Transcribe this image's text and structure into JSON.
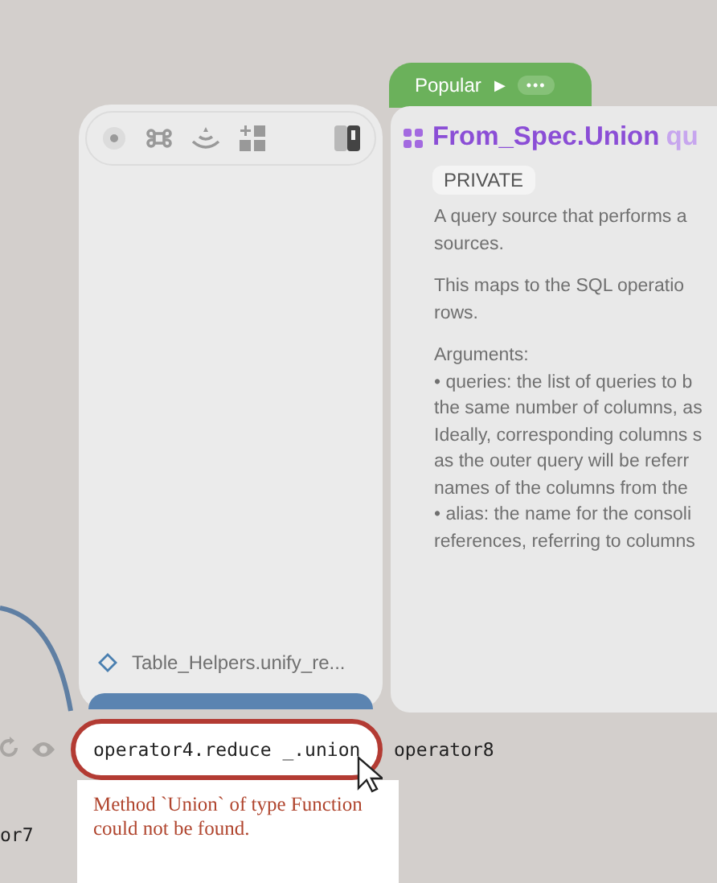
{
  "browser": {
    "toolbar": [
      {
        "kind": "dot"
      },
      {
        "kind": "command"
      },
      {
        "kind": "fountain"
      },
      {
        "kind": "grid"
      }
    ],
    "toggle": {
      "on": true
    },
    "entries": [
      {
        "label": "Table_Helpers.unify_re..."
      }
    ]
  },
  "popular": {
    "label": "Popular",
    "play": "▶",
    "more": "•••"
  },
  "doc": {
    "title": "From_Spec.Union",
    "title_suffix": "qu",
    "tag": "PRIVATE",
    "paragraphs": [
      [
        "A query source that performs a",
        "sources."
      ],
      [
        "This maps to the SQL operatio",
        "rows."
      ],
      [
        "Arguments:",
        "• queries: the list of queries to b",
        "the same number of columns, as",
        "Ideally, corresponding columns s",
        "as the outer query will be referr",
        "names of the columns from the",
        "• alias: the name for the consoli",
        "references, referring to columns"
      ]
    ]
  },
  "node": {
    "value": "operator4.reduce _.union",
    "output": "operator8",
    "error": "Method `Union` of type Function could not be found."
  },
  "other_node": {
    "label": "or7"
  }
}
